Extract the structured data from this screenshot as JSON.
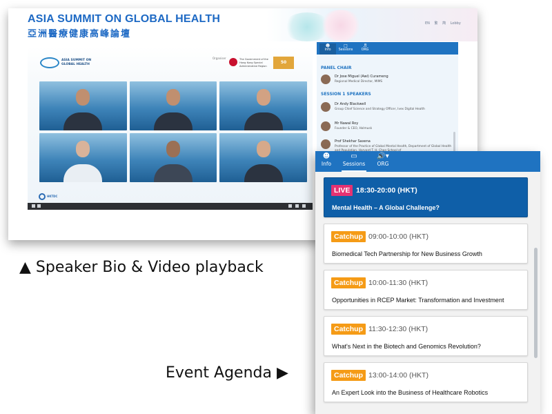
{
  "back_window": {
    "title_en": "ASIA SUMMIT ON GLOBAL HEALTH",
    "title_zh": "亞洲醫療健康高峰論壇",
    "header_links": [
      "EN",
      "繁",
      "简",
      "Lobby"
    ],
    "video": {
      "logo_text": "ASIA SUMMIT ON GLOBAL HEALTH",
      "organiser_label": "Organiser",
      "gov_text": "The Government of the Hong Kong Special Administrative Region",
      "hktdc_text": "HKTDC"
    },
    "bio_panel": {
      "tabs": [
        {
          "label": "Info"
        },
        {
          "label": "Sessions"
        },
        {
          "label": "ORG"
        }
      ],
      "panel_chair_heading": "PANEL CHAIR",
      "chair": {
        "name": "Dr Jose Miguel (Awi) Curameng",
        "title": "Regional Medical Director, MIMS"
      },
      "session_heading": "SESSION 1 SPEAKERS",
      "speakers": [
        {
          "name": "Dr Andy Blackwell",
          "title": "Group Chief Science and Strategy Officer, Ivex Digital Health"
        },
        {
          "name": "Mr Nawal Roy",
          "title": "Founder & CEO, Holmusk"
        },
        {
          "name": "Prof Shekhar Saxena",
          "title": "Professor of the Practice of Global Mental Health, Department of Global Health and Population, Harvard T. H. Chan School of"
        }
      ]
    }
  },
  "agenda": {
    "tabs": [
      {
        "label": "Info"
      },
      {
        "label": "Sessions"
      },
      {
        "label": "ORG"
      }
    ],
    "sessions": [
      {
        "badge": "LIVE",
        "time": "18:30-20:00 (HKT)",
        "title": "Mental Health – A Global Challenge?"
      },
      {
        "badge": "Catchup",
        "time": "09:00-10:00 (HKT)",
        "title": "Biomedical Tech Partnership for New Business Growth"
      },
      {
        "badge": "Catchup",
        "time": "10:00-11:30 (HKT)",
        "title": "Opportunities in RCEP Market: Transformation and Investment"
      },
      {
        "badge": "Catchup",
        "time": "11:30-12:30 (HKT)",
        "title": "What's Next in the Biotech and Genomics Revolution?"
      },
      {
        "badge": "Catchup",
        "time": "13:00-14:00 (HKT)",
        "title": "An Expert Look into the Business of Healthcare Robotics"
      }
    ]
  },
  "captions": {
    "left": "▲ Speaker Bio & Video playback",
    "bottom": "Event Agenda ▶"
  },
  "colors": {
    "brand_blue": "#1f73c1",
    "live_pink": "#e53272",
    "catchup_orange": "#f59b16"
  }
}
